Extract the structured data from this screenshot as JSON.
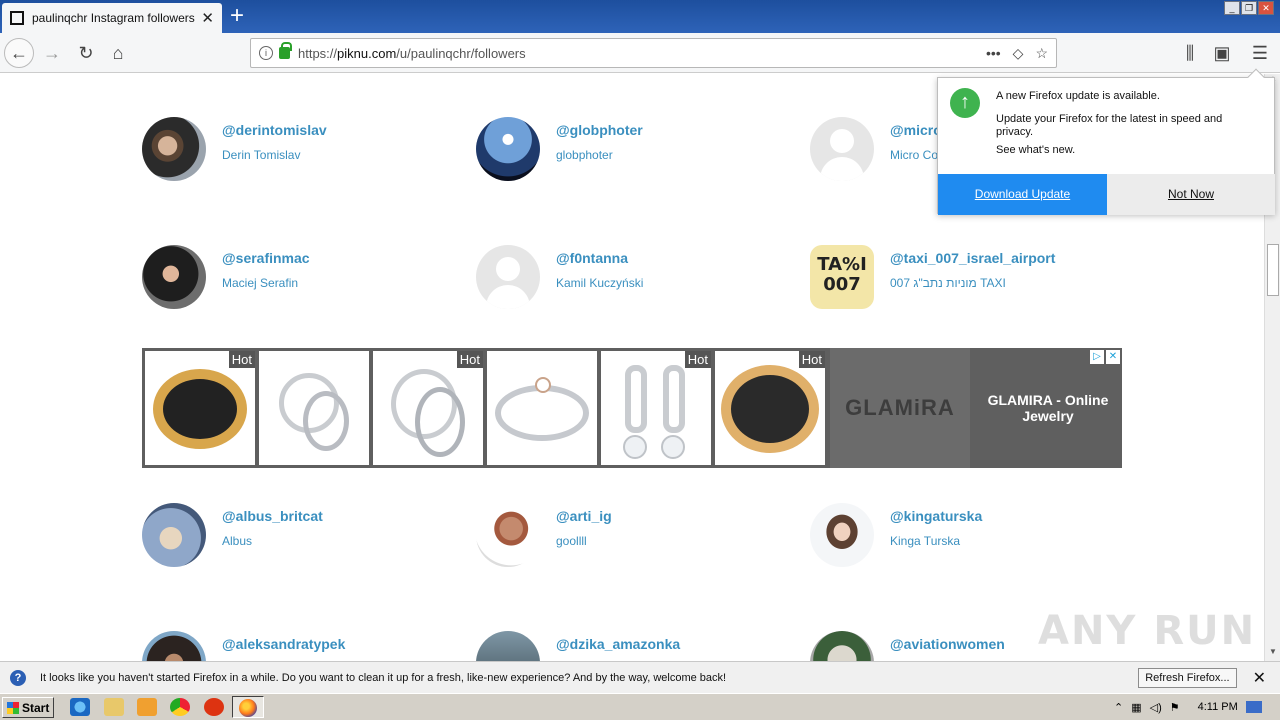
{
  "browser": {
    "tab_title": "paulinqchr Instagram followers - Pi",
    "url_prefix": "https://",
    "url_host": "piknu.com",
    "url_path": "/u/paulinqchr/followers"
  },
  "followers": [
    {
      "username": "@derintomislav",
      "name": "Derin Tomislav"
    },
    {
      "username": "@globphoter",
      "name": "globphoter"
    },
    {
      "username": "@micro",
      "name": "Micro Co"
    },
    {
      "username": "@serafinmac",
      "name": "Maciej Serafin"
    },
    {
      "username": "@f0ntanna",
      "name": "Kamil Kuczyński"
    },
    {
      "username": "@taxi_007_israel_airport",
      "name": "מוניות נתב\"ג 007 TAXI"
    },
    {
      "username": "@albus_britcat",
      "name": "Albus"
    },
    {
      "username": "@arti_ig",
      "name": "goollll"
    },
    {
      "username": "@kingaturska",
      "name": "Kinga Turska"
    },
    {
      "username": "@aleksandratypek",
      "name": ""
    },
    {
      "username": "@dzika_amazonka",
      "name": ""
    },
    {
      "username": "@aviationwomen",
      "name": ""
    }
  ],
  "taxi_avatar_text": "TA%I 007",
  "ad": {
    "hot_label": "Hot",
    "brand_logo": "GLAMiRA",
    "text": "GLAMIRA - Online Jewelry"
  },
  "update_popup": {
    "title": "A new Firefox update is available.",
    "body": "Update your Firefox for the latest in speed and privacy.",
    "link": "See what's new.",
    "download": "Download Update",
    "not_now": "Not Now"
  },
  "notification": {
    "message": "It looks like you haven't started Firefox in a while. Do you want to clean it up for a fresh, like-new experience? And by the way, welcome back!",
    "refresh": "Refresh Firefox..."
  },
  "taskbar": {
    "start": "Start",
    "clock": "4:11 PM"
  },
  "watermark": "ANY RUN",
  "colors": {
    "link": "#3a8fbf",
    "accent_button": "#1f8bf0",
    "update_icon": "#3fb34f"
  }
}
